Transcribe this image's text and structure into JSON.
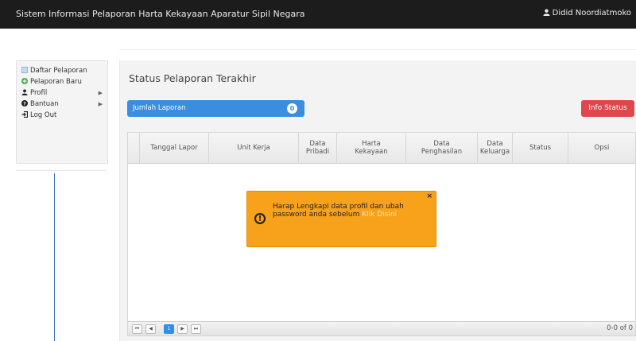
{
  "header": {
    "title": "Sistem Informasi Pelaporan Harta Kekayaan Aparatur Sipil Negara",
    "user_name": "Didid Noordiatmoko"
  },
  "sidebar": {
    "items": [
      {
        "label": "Daftar Pelaporan",
        "icon": "list-icon"
      },
      {
        "label": "Pelaporan Baru",
        "icon": "plus-circle-icon"
      },
      {
        "label": "Profil",
        "icon": "user-icon",
        "submenu": true
      },
      {
        "label": "Bantuan",
        "icon": "question-icon",
        "submenu": true
      },
      {
        "label": "Log Out",
        "icon": "logout-icon"
      }
    ]
  },
  "main": {
    "title": "Status Pelaporan Terakhir",
    "jumlah_label": "Jumlah Laporan",
    "jumlah_count": "0",
    "info_status_label": "Info Status"
  },
  "table": {
    "columns": [
      {
        "l1": "Tanggal Lapor",
        "l2": ""
      },
      {
        "l1": "Unit Kerja",
        "l2": ""
      },
      {
        "l1": "Data",
        "l2": "Pribadi"
      },
      {
        "l1": "Harta",
        "l2": "Kekayaan"
      },
      {
        "l1": "Data",
        "l2": "Penghasilan"
      },
      {
        "l1": "Data",
        "l2": "Keluarga"
      },
      {
        "l1": "Status",
        "l2": ""
      },
      {
        "l1": "Opsi",
        "l2": ""
      }
    ],
    "current_page": "1",
    "record_info": "0-0 of 0"
  },
  "alert": {
    "message": "Harap Lengkapi data profil dan ubah password anda sebelum ",
    "link_text": "Klik Disini",
    "close": "×"
  },
  "colors": {
    "topbar": "#1c1c1c",
    "primary": "#3a8ee0",
    "danger": "#e0474c",
    "warning": "#f7a21a"
  }
}
